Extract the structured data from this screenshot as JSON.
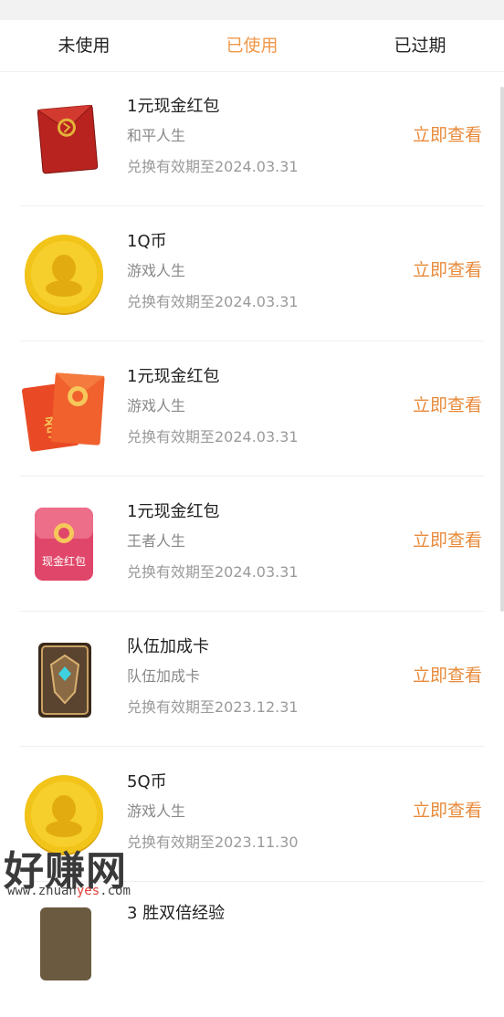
{
  "tabs": [
    {
      "label": "未使用",
      "active": false
    },
    {
      "label": "已使用",
      "active": true
    },
    {
      "label": "已过期",
      "active": false
    }
  ],
  "items": [
    {
      "title": "1元现金红包",
      "source": "和平人生",
      "expiry": "兑换有效期至2024.03.31",
      "action": "立即查看",
      "icon": "red-envelope-icon"
    },
    {
      "title": "1Q币",
      "source": "游戏人生",
      "expiry": "兑换有效期至2024.03.31",
      "action": "立即查看",
      "icon": "q-coin-icon"
    },
    {
      "title": "1元现金红包",
      "source": "游戏人生",
      "expiry": "兑换有效期至2024.03.31",
      "action": "立即查看",
      "icon": "fa-red-envelopes-icon"
    },
    {
      "title": "1元现金红包",
      "source": "王者人生",
      "expiry": "兑换有效期至2024.03.31",
      "action": "立即查看",
      "icon": "cash-red-packet-icon",
      "icon_text": "现金红包"
    },
    {
      "title": "队伍加成卡",
      "source": "队伍加成卡",
      "expiry": "兑换有效期至2023.12.31",
      "action": "立即查看",
      "icon": "team-bonus-card-icon"
    },
    {
      "title": "5Q币",
      "source": "游戏人生",
      "expiry": "兑换有效期至2023.11.30",
      "action": "立即查看",
      "icon": "q-coin-icon"
    },
    {
      "title": "3 胜双倍经验",
      "source": "",
      "expiry": "",
      "action": "",
      "icon": "card-icon"
    }
  ],
  "watermark": {
    "main": "好赚网",
    "url_prefix": "www.zhuan",
    "url_highlight": "yes",
    "url_suffix": ".com"
  },
  "colors": {
    "accent": "#e98a3a",
    "active_tab": "#f0984a",
    "coin_gold": "#f2c41a",
    "envelope_red": "#c8302b"
  }
}
